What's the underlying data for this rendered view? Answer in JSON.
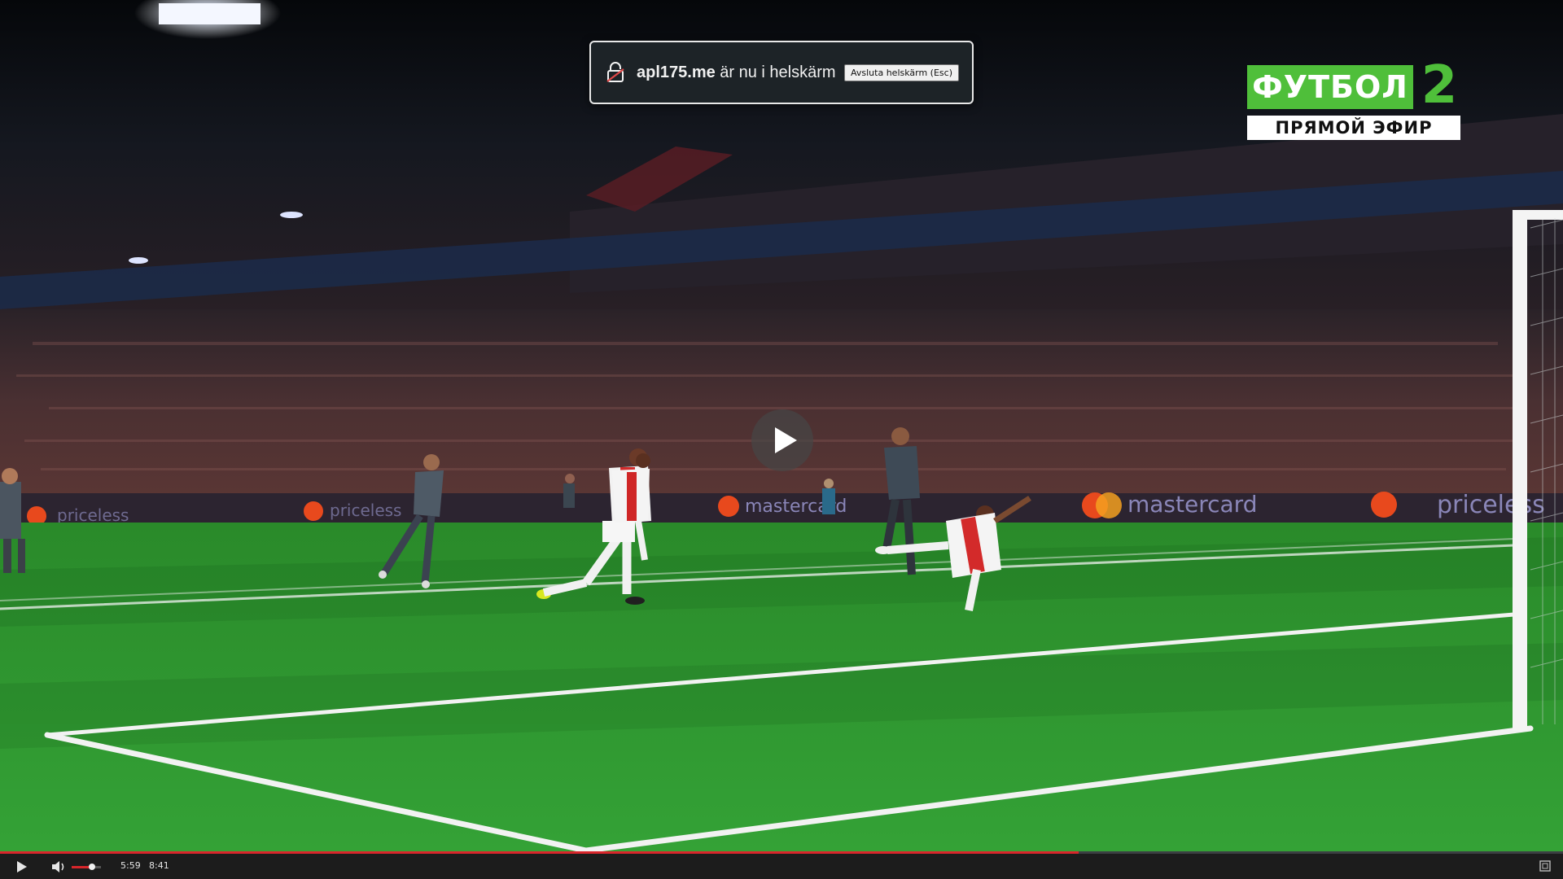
{
  "notification": {
    "domain": "apl175.me",
    "message": " är nu i helskärm",
    "exit_button": "Avsluta helskärm (Esc)",
    "icon": "lock-icon"
  },
  "channel": {
    "name": "ФУТБОЛ",
    "number": "2",
    "subtitle": "ПРЯМОЙ ЭФИР",
    "color": "#4fbf3a"
  },
  "player": {
    "current_time": "5:59",
    "duration": "8:41",
    "progress_fraction": 0.69,
    "volume_fraction": 0.7,
    "accent_color": "#d8262b",
    "icons": [
      "play-icon",
      "volume-icon",
      "fullscreen-icon",
      "big-play-icon"
    ]
  },
  "scene": {
    "board_text": "mastercard"
  }
}
